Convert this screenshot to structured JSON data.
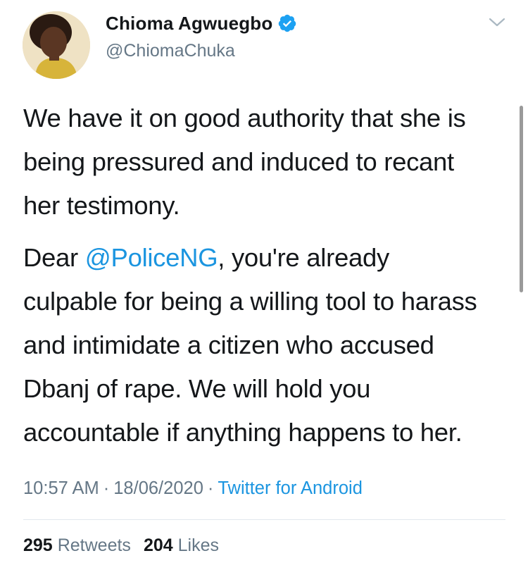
{
  "author": {
    "display_name": "Chioma Agwuegbo",
    "handle": "@ChiomaChuka",
    "verified": true
  },
  "tweet": {
    "paragraph1": [
      "We have it on good authority that she is",
      "being pressured and induced to recant",
      "her testimony."
    ],
    "paragraph2": {
      "line1_prefix": "Dear ",
      "mention": "@PoliceNG",
      "line1_suffix": ", you're already",
      "lines": [
        "culpable for being a willing tool to harass",
        "and intimidate a citizen who accused",
        "Dbanj of rape. We will hold you",
        "accountable if anything happens to her."
      ]
    },
    "time": "10:57 AM",
    "date": "18/06/2020",
    "source": "Twitter for Android",
    "separator": "·"
  },
  "stats": {
    "retweets_count": "295",
    "retweets_label": "Retweets",
    "likes_count": "204",
    "likes_label": "Likes"
  },
  "icons": {
    "verified": "verified-badge-icon",
    "caret": "chevron-down-icon"
  },
  "colors": {
    "link": "#1b95e0",
    "secondary_text": "#657786",
    "primary_text": "#14171a"
  }
}
